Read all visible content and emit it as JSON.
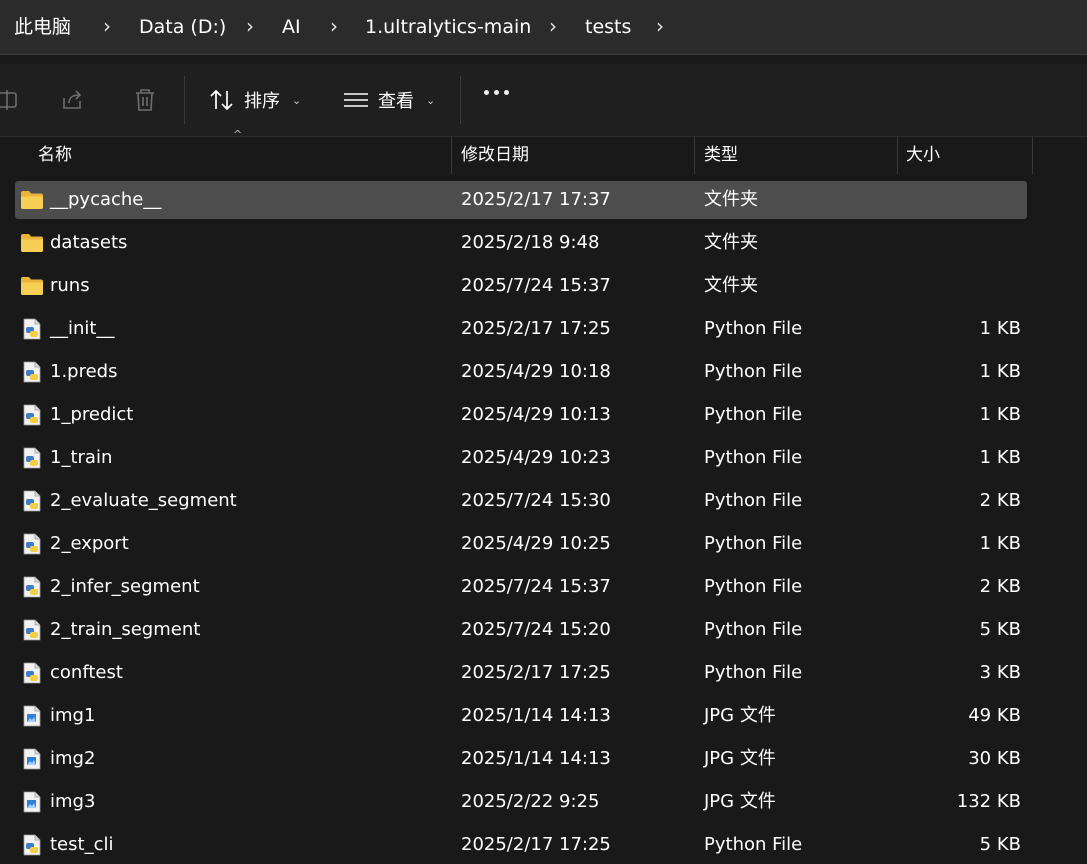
{
  "breadcrumb": [
    "此电脑",
    "Data (D:)",
    "AI",
    "1.ultralytics-main",
    "tests"
  ],
  "toolbar": {
    "sort_label": "排序",
    "view_label": "查看"
  },
  "columns": {
    "name": "名称",
    "date": "修改日期",
    "type": "类型",
    "size": "大小"
  },
  "files": [
    {
      "icon": "folder-icon",
      "name": "__pycache__",
      "date": "2025/2/17 17:37",
      "type": "文件夹",
      "size": "",
      "selected": true
    },
    {
      "icon": "folder-icon",
      "name": "datasets",
      "date": "2025/2/18 9:48",
      "type": "文件夹",
      "size": ""
    },
    {
      "icon": "folder-icon",
      "name": "runs",
      "date": "2025/7/24 15:37",
      "type": "文件夹",
      "size": ""
    },
    {
      "icon": "python-file-icon",
      "name": "__init__",
      "date": "2025/2/17 17:25",
      "type": "Python File",
      "size": "1 KB"
    },
    {
      "icon": "python-file-icon",
      "name": "1.preds",
      "date": "2025/4/29 10:18",
      "type": "Python File",
      "size": "1 KB"
    },
    {
      "icon": "python-file-icon",
      "name": "1_predict",
      "date": "2025/4/29 10:13",
      "type": "Python File",
      "size": "1 KB"
    },
    {
      "icon": "python-file-icon",
      "name": "1_train",
      "date": "2025/4/29 10:23",
      "type": "Python File",
      "size": "1 KB"
    },
    {
      "icon": "python-file-icon",
      "name": "2_evaluate_segment",
      "date": "2025/7/24 15:30",
      "type": "Python File",
      "size": "2 KB"
    },
    {
      "icon": "python-file-icon",
      "name": "2_export",
      "date": "2025/4/29 10:25",
      "type": "Python File",
      "size": "1 KB"
    },
    {
      "icon": "python-file-icon",
      "name": "2_infer_segment",
      "date": "2025/7/24 15:37",
      "type": "Python File",
      "size": "2 KB"
    },
    {
      "icon": "python-file-icon",
      "name": "2_train_segment",
      "date": "2025/7/24 15:20",
      "type": "Python File",
      "size": "5 KB"
    },
    {
      "icon": "python-file-icon",
      "name": "conftest",
      "date": "2025/2/17 17:25",
      "type": "Python File",
      "size": "3 KB"
    },
    {
      "icon": "image-file-icon",
      "name": "img1",
      "date": "2025/1/14 14:13",
      "type": "JPG 文件",
      "size": "49 KB"
    },
    {
      "icon": "image-file-icon",
      "name": "img2",
      "date": "2025/1/14 14:13",
      "type": "JPG 文件",
      "size": "30 KB"
    },
    {
      "icon": "image-file-icon",
      "name": "img3",
      "date": "2025/2/22 9:25",
      "type": "JPG 文件",
      "size": "132 KB"
    },
    {
      "icon": "python-file-icon",
      "name": "test_cli",
      "date": "2025/2/17 17:25",
      "type": "Python File",
      "size": "5 KB"
    }
  ],
  "colors": {
    "folder": "#f5c84c",
    "selection": "#4d4d4d",
    "background": "#191919",
    "python_blue": "#3f7cc6",
    "python_yellow": "#f4cf45"
  }
}
